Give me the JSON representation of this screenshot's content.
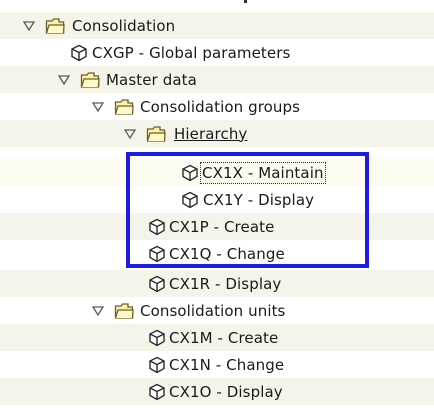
{
  "tree": {
    "items": [
      {
        "label": "Consolidation",
        "type": "folder",
        "expanded": true
      },
      {
        "label": "CXGP - Global parameters",
        "type": "transaction"
      },
      {
        "label": "Master data",
        "type": "folder",
        "expanded": true
      },
      {
        "label": "Consolidation groups",
        "type": "folder",
        "expanded": true
      },
      {
        "label": "Hierarchy",
        "type": "folder",
        "expanded": true
      },
      {
        "label": "CX1X - Maintain",
        "type": "transaction",
        "focused": true
      },
      {
        "label": "CX1Y - Display",
        "type": "transaction"
      },
      {
        "label": "CX1P - Create",
        "type": "transaction"
      },
      {
        "label": "CX1Q - Change",
        "type": "transaction"
      },
      {
        "label": "CX1R - Display",
        "type": "transaction"
      },
      {
        "label": "Consolidation units",
        "type": "folder",
        "expanded": true
      },
      {
        "label": "CX1M - Create",
        "type": "transaction"
      },
      {
        "label": "CX1N - Change",
        "type": "transaction"
      },
      {
        "label": "CX1O - Display",
        "type": "transaction"
      }
    ]
  },
  "icons": {
    "folder": "open-folder-icon",
    "transaction": "transaction-cube-icon",
    "expander": "triangle-expanded-icon"
  },
  "colors": {
    "folder_fill": "#fff2a8",
    "folder_stroke": "#6b6226",
    "highlight_box": "#1c1ce6",
    "row_alt": "#f5f4ea"
  }
}
